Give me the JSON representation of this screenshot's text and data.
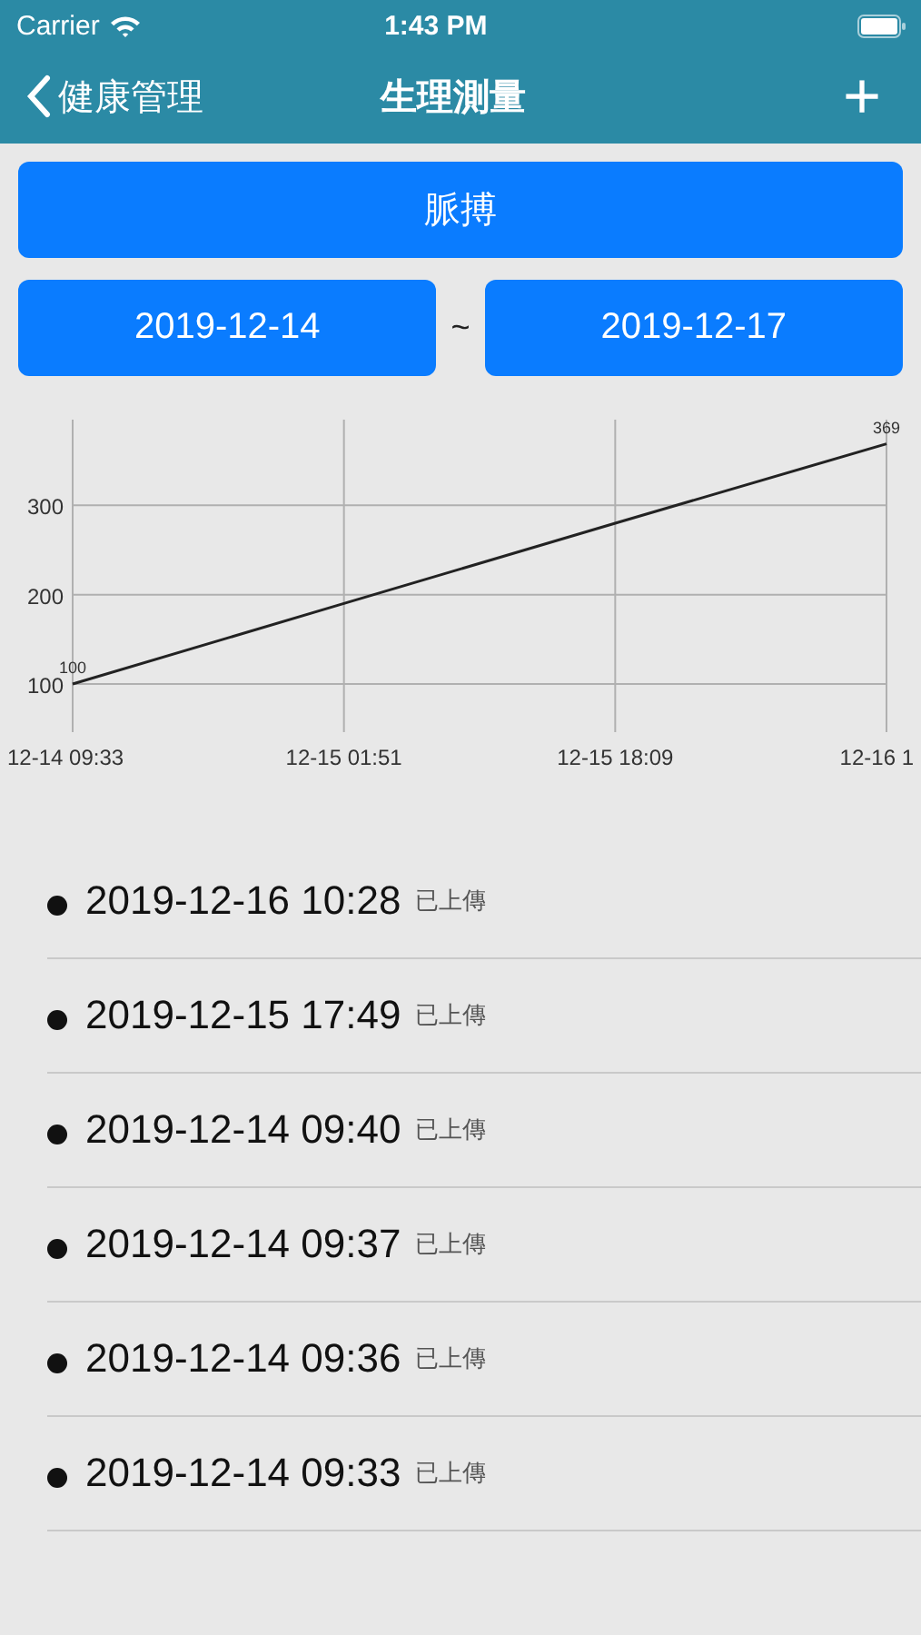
{
  "status_bar": {
    "carrier": "Carrier",
    "time": "1:43 PM"
  },
  "nav": {
    "back_label": "健康管理",
    "title": "生理測量",
    "add_label": "+"
  },
  "measure_button": "脈搏",
  "date_range": {
    "start": "2019-12-14",
    "separator": "~",
    "end": "2019-12-17"
  },
  "chart": {
    "chart_data": {
      "type": "line",
      "categories": [
        "12-14 09:33",
        "12-15 01:51",
        "12-15 18:09",
        "12-16 1"
      ],
      "series": [
        {
          "color": "#222222",
          "values": [
            100,
            190,
            280,
            369
          ]
        }
      ],
      "ylim": [
        46,
        396
      ],
      "grid": true,
      "value_labels": [
        "100",
        null,
        null,
        "369"
      ],
      "yticks": [
        100,
        200,
        300
      ]
    }
  },
  "records": [
    {
      "time": "2019-12-16 10:28",
      "status": "已上傳"
    },
    {
      "time": "2019-12-15 17:49",
      "status": "已上傳"
    },
    {
      "time": "2019-12-14 09:40",
      "status": "已上傳"
    },
    {
      "time": "2019-12-14 09:37",
      "status": "已上傳"
    },
    {
      "time": "2019-12-14 09:36",
      "status": "已上傳"
    },
    {
      "time": "2019-12-14 09:33",
      "status": "已上傳"
    }
  ]
}
